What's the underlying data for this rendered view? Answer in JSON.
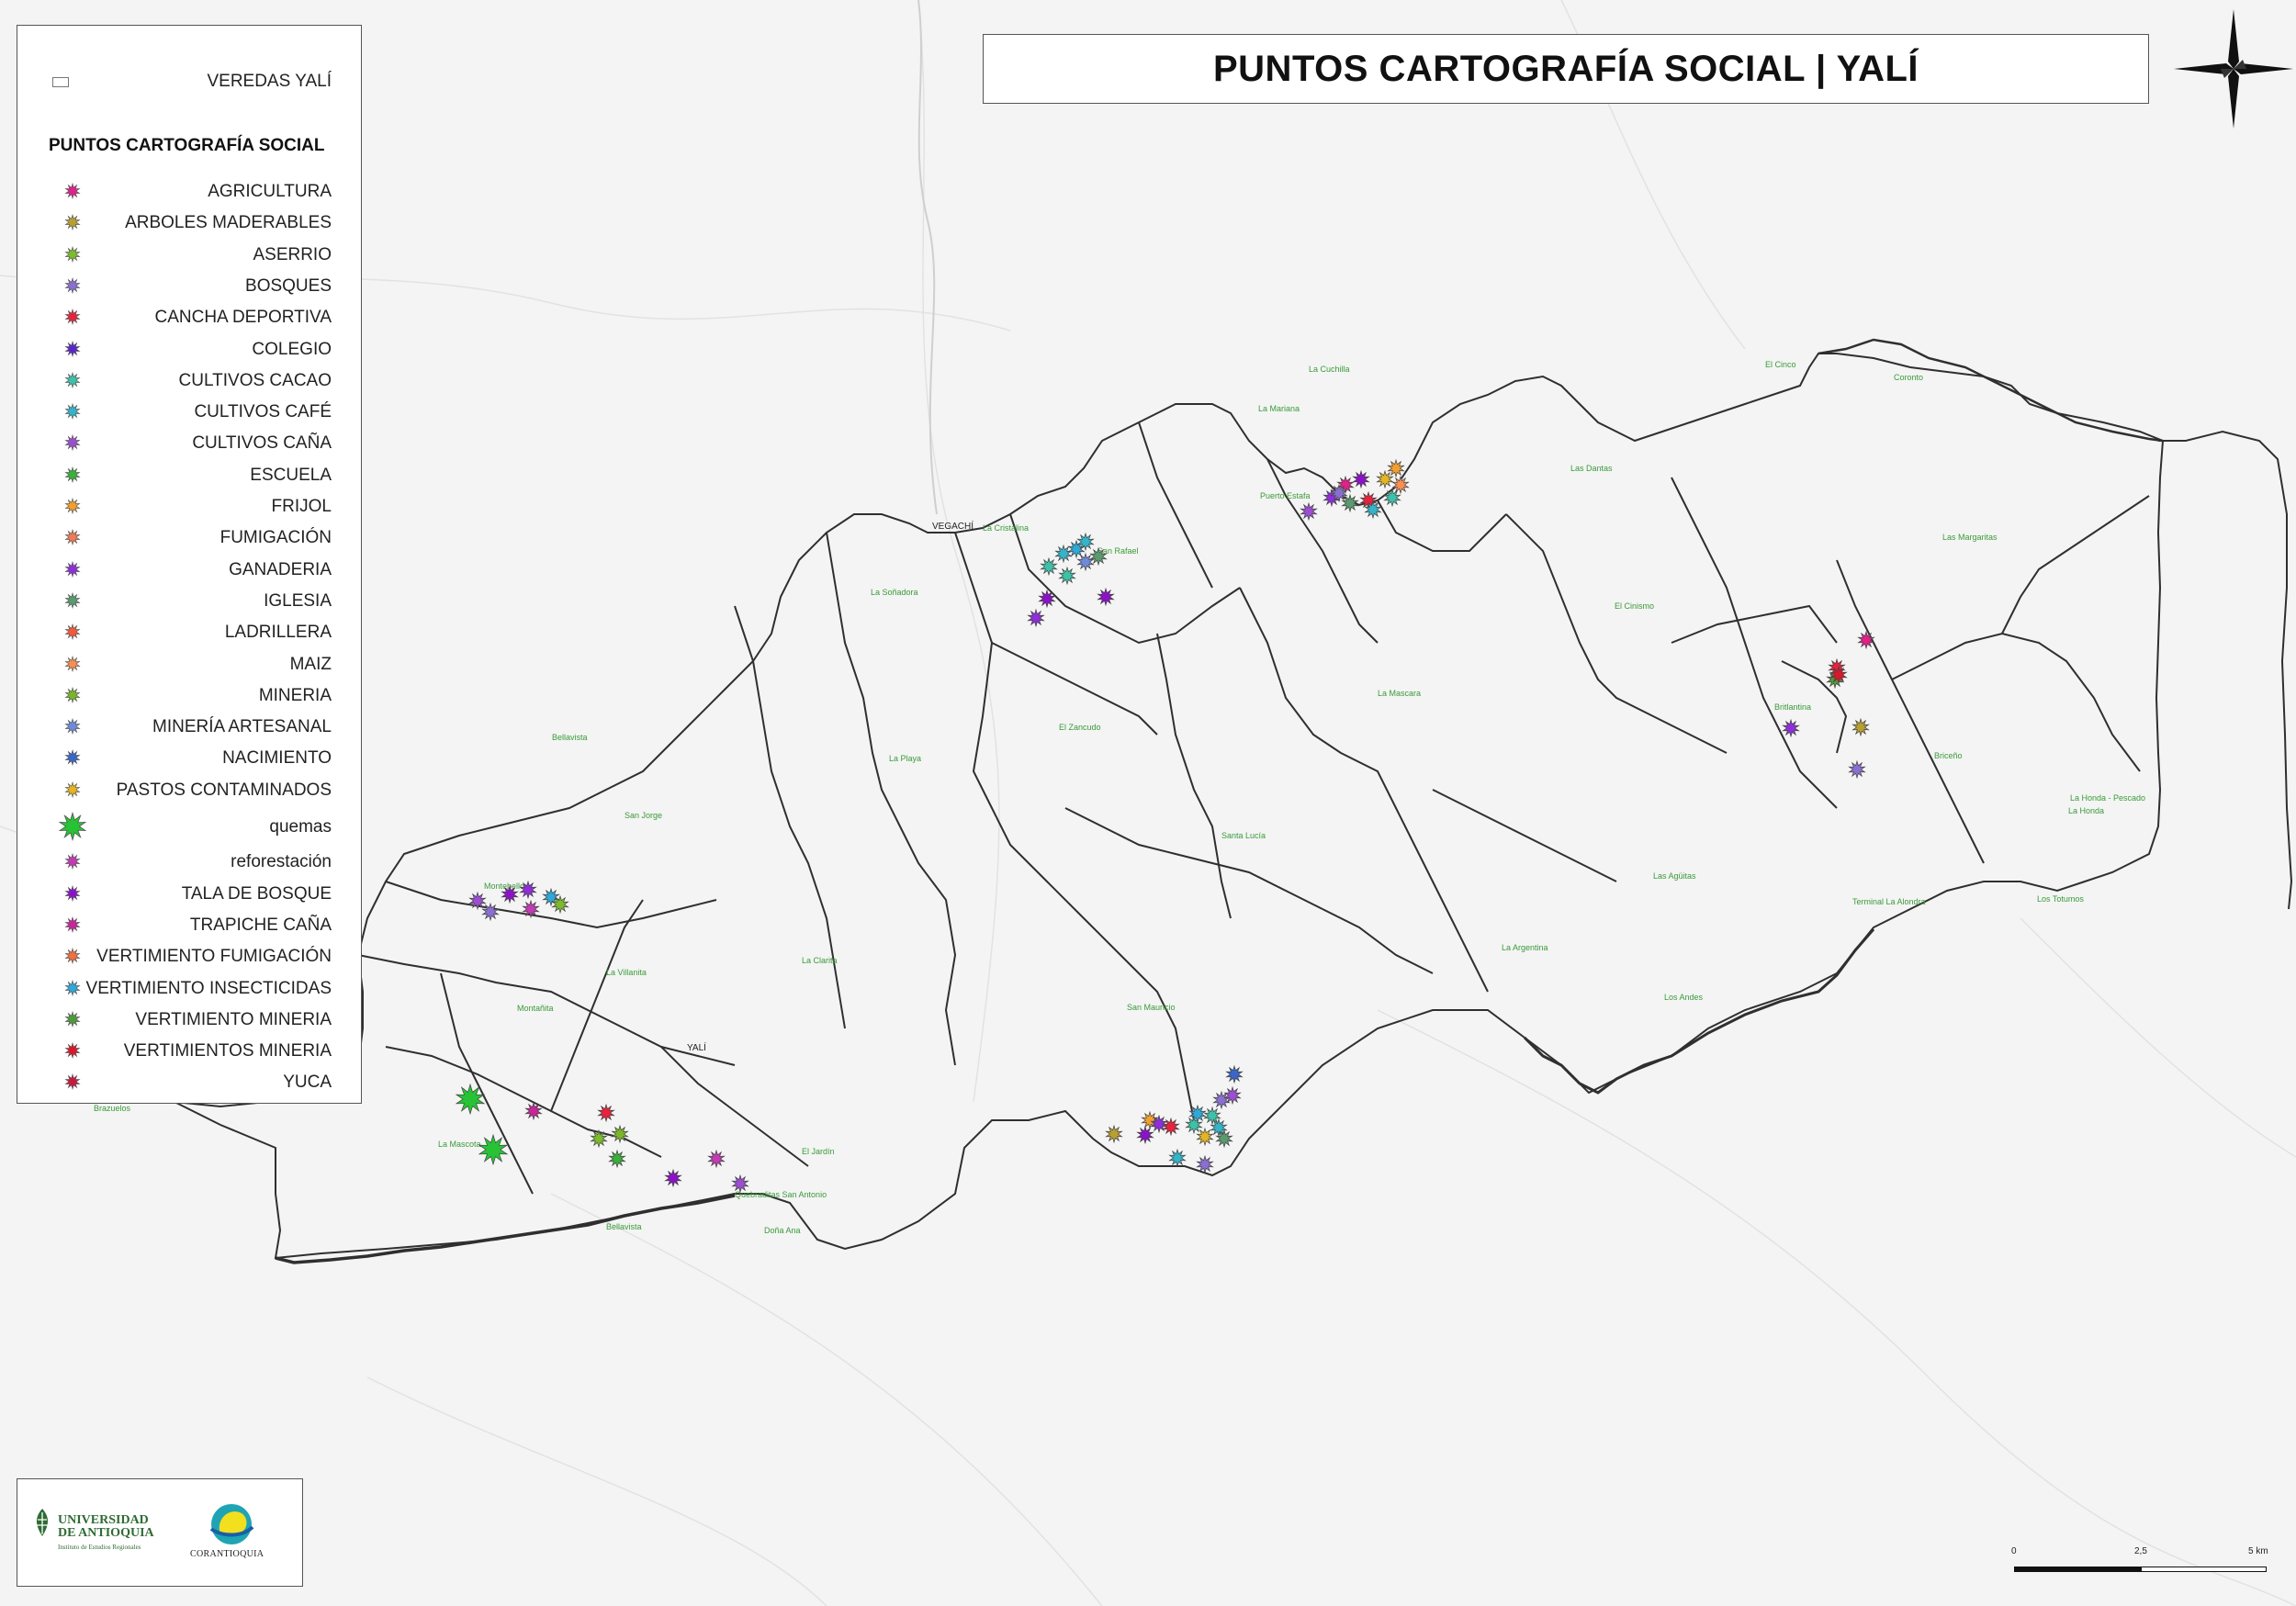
{
  "title": "PUNTOS CARTOGRAFÍA SOCIAL | YALÍ",
  "legend": {
    "boundary_label": "VEREDAS YALÍ",
    "heading": "PUNTOS CARTOGRAFÍA SOCIAL",
    "items": [
      {
        "label": "AGRICULTURA",
        "color": "#e0218a"
      },
      {
        "label": "ARBOLES MADERABLES",
        "color": "#b7a032"
      },
      {
        "label": "ASERRIO",
        "color": "#7dbb2e"
      },
      {
        "label": "BOSQUES",
        "color": "#8a6fd0"
      },
      {
        "label": "CANCHA DEPORTIVA",
        "color": "#e8223d"
      },
      {
        "label": "COLEGIO",
        "color": "#5a26c9"
      },
      {
        "label": "CULTIVOS CACAO",
        "color": "#3ec1a8"
      },
      {
        "label": "CULTIVOS CAFÉ",
        "color": "#35b3c9"
      },
      {
        "label": "CULTIVOS CAÑA",
        "color": "#9b4fd0"
      },
      {
        "label": "ESCUELA",
        "color": "#3ab03a"
      },
      {
        "label": "FRIJOL",
        "color": "#f0a030"
      },
      {
        "label": "FUMIGACIÓN",
        "color": "#f07a55"
      },
      {
        "label": "GANADERIA",
        "color": "#8e2fd9"
      },
      {
        "label": "IGLESIA",
        "color": "#5b9a6e"
      },
      {
        "label": "LADRILLERA",
        "color": "#f25a3c"
      },
      {
        "label": "MAIZ",
        "color": "#f58f52"
      },
      {
        "label": "MINERIA",
        "color": "#7bb52a"
      },
      {
        "label": "MINERÍA ARTESANAL",
        "color": "#6f8ad8"
      },
      {
        "label": "NACIMIENTO",
        "color": "#3a66c9"
      },
      {
        "label": "PASTOS CONTAMINADOS",
        "color": "#e3b425"
      },
      {
        "label": "quemas",
        "color": "#27c235"
      },
      {
        "label": "reforestación",
        "color": "#c23bb5"
      },
      {
        "label": "TALA DE BOSQUE",
        "color": "#8c12c9"
      },
      {
        "label": "TRAPICHE CAÑA",
        "color": "#c9259a"
      },
      {
        "label": "VERTIMIENTO FUMIGACIÓN",
        "color": "#f07040"
      },
      {
        "label": "VERTIMIENTO INSECTICIDAS",
        "color": "#2fa8d8"
      },
      {
        "label": "VERTIMIENTO MINERIA",
        "color": "#4f9a3a"
      },
      {
        "label": "VERTIMIENTOS MINERIA",
        "color": "#d8182b"
      },
      {
        "label": "YUCA",
        "color": "#c9183d"
      }
    ]
  },
  "places": [
    "La Mariana",
    "Puerto Estafa",
    "La Cuchilla",
    "El Cinco",
    "Coronto",
    "Las Dantas",
    "Las Margaritas",
    "El Cinismo",
    "VEGACHÍ",
    "La Cristalina",
    "San Rafael",
    "La Soñadora",
    "El Zancudo",
    "La Mascara",
    "La Playa",
    "Britlantina",
    "Briceño",
    "La Honda - Pescado",
    "La Honda",
    "Bellavista",
    "San Jorge",
    "Santa Lucía",
    "Las Agüitas",
    "Montebello",
    "Terminal La Alondra",
    "Los Totumos",
    "La Villanita",
    "La Clarita",
    "La Argentina",
    "Montañita",
    "Los Andes",
    "San Mauricio",
    "YALÍ",
    "Brazuelos",
    "La Mascota",
    "El Jardín",
    "Quebraditas San Antonio",
    "Bellavista",
    "Doña Ana",
    "ESCUELA"
  ],
  "logos": {
    "university_line1": "UNIVERSIDAD",
    "university_line2": "DE ANTIOQUIA",
    "university_sub": "Instituto de Estudios Regionales",
    "corantioquia": "CORANTIOQUIA"
  },
  "scale": {
    "t0": "0",
    "t1": "2,5",
    "t2": "5 km"
  }
}
